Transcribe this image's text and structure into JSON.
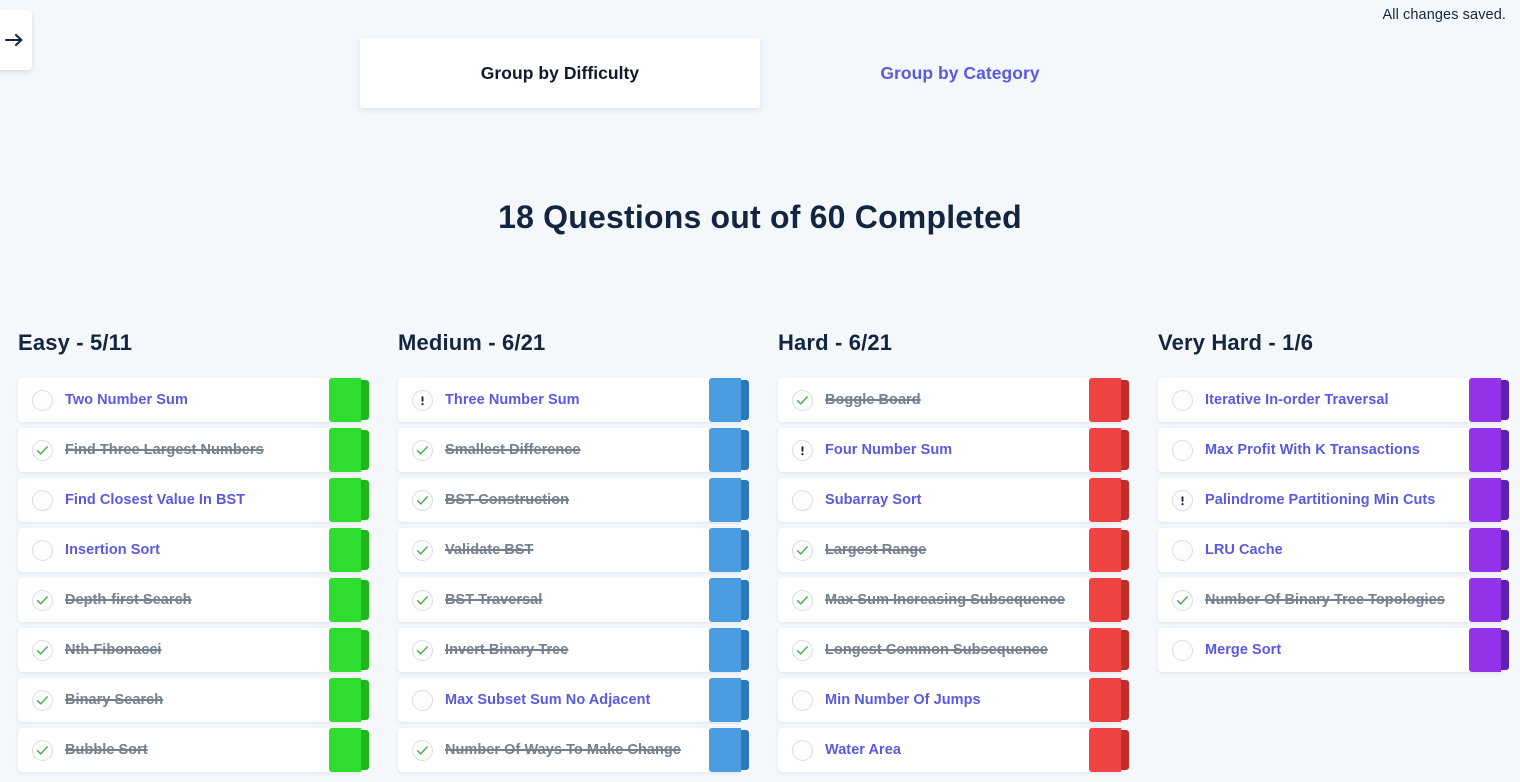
{
  "status": {
    "saved_text": "All changes saved."
  },
  "sidebar_toggle": {
    "icon": "arrow-right-icon"
  },
  "tabs": [
    {
      "label": "Group by Difficulty",
      "active": true
    },
    {
      "label": "Group by Category",
      "active": false
    }
  ],
  "progress": {
    "heading": "18 Questions out of 60 Completed",
    "completed": 18,
    "total": 60
  },
  "colors": {
    "background": "#f4f8fb",
    "card": "#ffffff",
    "accent_purple": "#5a5ae0",
    "text_dark": "#13253f",
    "text_done": "#76808f",
    "easy_bar": "#2fdd2f",
    "easy_bar_edge": "#1eb81e",
    "medium_bar": "#4a9de0",
    "medium_bar_edge": "#2b78bb",
    "hard_bar": "#ef4444",
    "hard_bar_edge": "#c42b2b",
    "very_hard_bar": "#9333ea",
    "very_hard_bar_edge": "#5b21b6",
    "check_green": "#4caf50"
  },
  "columns": [
    {
      "key": "easy",
      "title": "Easy - 5/11",
      "difficulty": "Easy",
      "completed": 5,
      "total": 11,
      "bar_color": "#2fdd2f",
      "bar_edge_color": "#1eb81e",
      "questions": [
        {
          "name": "Two Number Sum",
          "status": "todo"
        },
        {
          "name": "Find Three Largest Numbers",
          "status": "done"
        },
        {
          "name": "Find Closest Value In BST",
          "status": "todo"
        },
        {
          "name": "Insertion Sort",
          "status": "todo"
        },
        {
          "name": "Depth-first Search",
          "status": "done"
        },
        {
          "name": "Nth Fibonacci",
          "status": "done"
        },
        {
          "name": "Binary Search",
          "status": "done"
        },
        {
          "name": "Bubble Sort",
          "status": "done"
        }
      ]
    },
    {
      "key": "medium",
      "title": "Medium - 6/21",
      "difficulty": "Medium",
      "completed": 6,
      "total": 21,
      "bar_color": "#4a9de0",
      "bar_edge_color": "#2b78bb",
      "questions": [
        {
          "name": "Three Number Sum",
          "status": "flagged"
        },
        {
          "name": "Smallest Difference",
          "status": "done"
        },
        {
          "name": "BST Construction",
          "status": "done"
        },
        {
          "name": "Validate BST",
          "status": "done"
        },
        {
          "name": "BST Traversal",
          "status": "done"
        },
        {
          "name": "Invert Binary Tree",
          "status": "done"
        },
        {
          "name": "Max Subset Sum No Adjacent",
          "status": "todo"
        },
        {
          "name": "Number Of Ways To Make Change",
          "status": "done"
        }
      ]
    },
    {
      "key": "hard",
      "title": "Hard - 6/21",
      "difficulty": "Hard",
      "completed": 6,
      "total": 21,
      "bar_color": "#ef4444",
      "bar_edge_color": "#c42b2b",
      "questions": [
        {
          "name": "Boggle Board",
          "status": "done"
        },
        {
          "name": "Four Number Sum",
          "status": "flagged"
        },
        {
          "name": "Subarray Sort",
          "status": "todo"
        },
        {
          "name": "Largest Range",
          "status": "done"
        },
        {
          "name": "Max Sum Increasing Subsequence",
          "status": "done"
        },
        {
          "name": "Longest Common Subsequence",
          "status": "done"
        },
        {
          "name": "Min Number Of Jumps",
          "status": "todo"
        },
        {
          "name": "Water Area",
          "status": "todo"
        }
      ]
    },
    {
      "key": "very-hard",
      "title": "Very Hard - 1/6",
      "difficulty": "Very Hard",
      "completed": 1,
      "total": 6,
      "bar_color": "#9333ea",
      "bar_edge_color": "#5b21b6",
      "questions": [
        {
          "name": "Iterative In-order Traversal",
          "status": "todo"
        },
        {
          "name": "Max Profit With K Transactions",
          "status": "todo"
        },
        {
          "name": "Palindrome Partitioning Min Cuts",
          "status": "flagged"
        },
        {
          "name": "LRU Cache",
          "status": "todo"
        },
        {
          "name": "Number Of Binary Tree Topologies",
          "status": "done"
        },
        {
          "name": "Merge Sort",
          "status": "todo"
        }
      ]
    }
  ]
}
